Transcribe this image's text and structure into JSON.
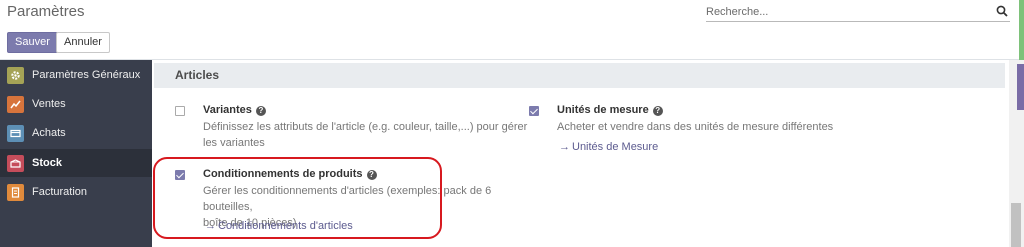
{
  "header": {
    "title": "Paramètres",
    "save_label": "Sauver",
    "cancel_label": "Annuler",
    "search_placeholder": "Recherche..."
  },
  "sidebar": {
    "items": [
      {
        "label": "Paramètres Généraux",
        "icon": "settings-icon",
        "color": "#a5a356"
      },
      {
        "label": "Ventes",
        "icon": "chart-icon",
        "color": "#d7743c"
      },
      {
        "label": "Achats",
        "icon": "card-icon",
        "color": "#5d8fb5"
      },
      {
        "label": "Stock",
        "icon": "box-icon",
        "color": "#c54d5b",
        "active": true
      },
      {
        "label": "Facturation",
        "icon": "invoice-icon",
        "color": "#e08a3c"
      }
    ]
  },
  "section": {
    "title": "Articles"
  },
  "settings": {
    "variantes": {
      "title": "Variantes",
      "checked": false,
      "desc_line1": "Définissez les attributs de l'article (e.g. couleur, taille,...) pour gérer",
      "desc_line2": "les variantes"
    },
    "unites": {
      "title": "Unités de mesure",
      "checked": true,
      "desc": "Acheter et vendre dans des unités de mesure différentes",
      "link": "Unités de Mesure"
    },
    "conditionnements": {
      "title": "Conditionnements de produits",
      "checked": true,
      "desc_line1": "Gérer les conditionnements d'articles (exemples: pack de 6 bouteilles,",
      "desc_line2": "boîte de 10 pièces)",
      "link": "Conditionnements d'articles"
    }
  },
  "colors": {
    "accent": "#7c7bad",
    "sidebar_bg": "#393e4c",
    "highlight": "#d7191f"
  }
}
